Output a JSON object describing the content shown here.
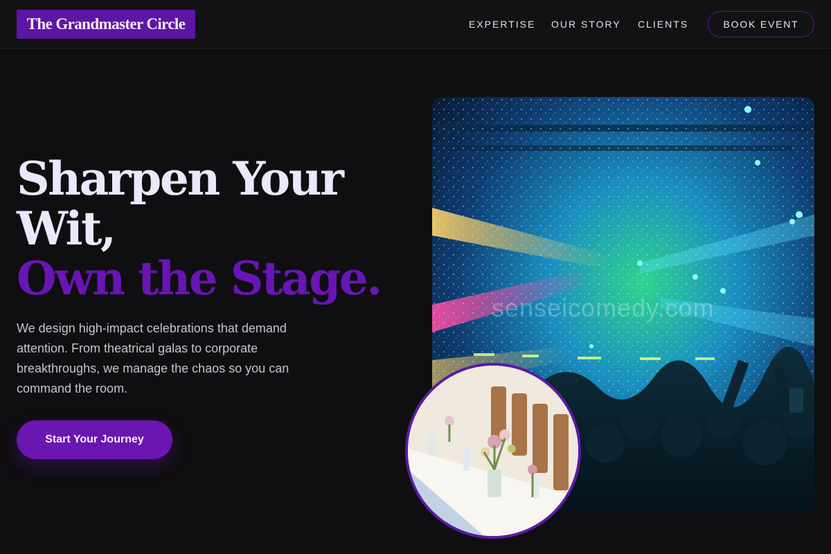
{
  "brand": {
    "name": "The Grandmaster Circle",
    "accent": "#6a16b0"
  },
  "nav": {
    "links": [
      "EXPERTISE",
      "OUR STORY",
      "CLIENTS"
    ],
    "cta": "BOOK EVENT"
  },
  "hero": {
    "title_line1": "Sharpen Your Wit,",
    "title_line2": "Own the Stage.",
    "subtitle": "We design high-impact celebrations that demand attention. From theatrical galas to corporate breakthroughs, we manage the chaos so you can command the room.",
    "cta": "Start Your Journey"
  },
  "images": {
    "watermark": "senseicomedy.com"
  }
}
